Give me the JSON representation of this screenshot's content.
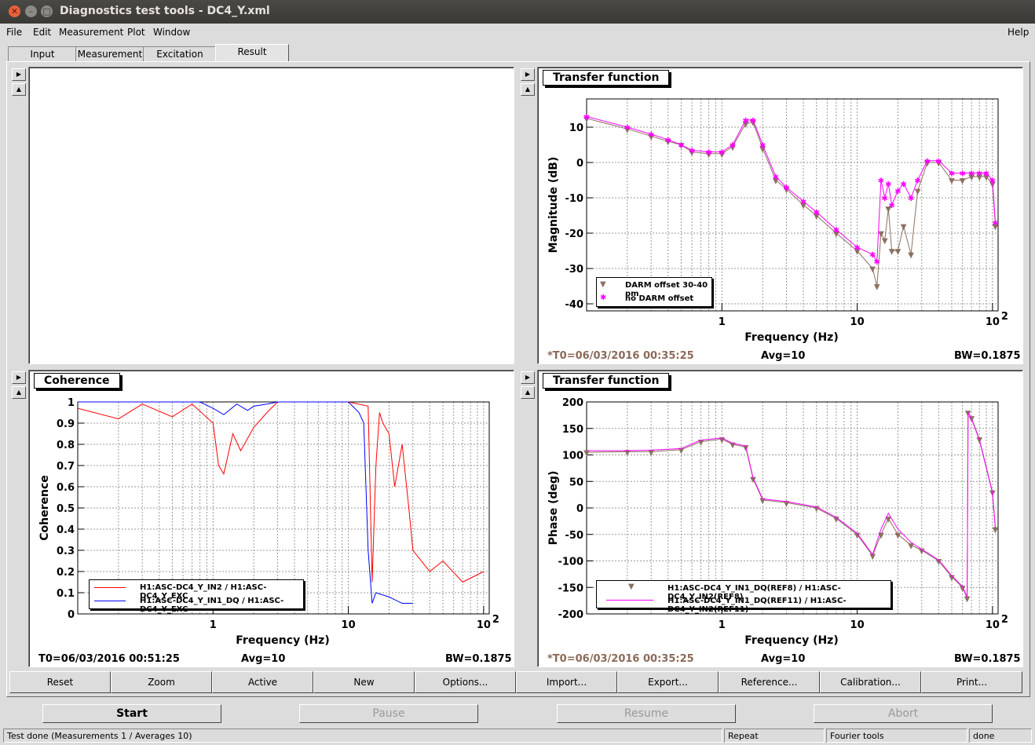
{
  "window": {
    "title": "Diagnostics test tools - DC4_Y.xml"
  },
  "menu": {
    "file": "File",
    "edit": "Edit",
    "measurement": "Measurement",
    "plot": "Plot",
    "window": "Window",
    "help": "Help"
  },
  "tabs": [
    "Input",
    "Measurement",
    "Excitation",
    "Result"
  ],
  "pads": {
    "tf_mag": {
      "title": "Transfer function",
      "ylabel": "Magnitude (dB)",
      "xlabel": "Frequency (Hz)",
      "yticks": [
        "10",
        "0",
        "-10",
        "-20",
        "-30",
        "-40"
      ],
      "xticks": [
        "1",
        "10",
        "10"
      ],
      "xsup": "2",
      "legend": [
        "DARM offset 30-40 pm",
        "no DARM offset"
      ],
      "foot": {
        "t0": "*T0=06/03/2016 00:35:25",
        "avg": "Avg=10",
        "bw": "BW=0.1875"
      }
    },
    "coherence": {
      "title": "Coherence",
      "ylabel": "Coherence",
      "xlabel": "Frequency (Hz)",
      "yticks": [
        "1",
        "0.9",
        "0.8",
        "0.7",
        "0.6",
        "0.5",
        "0.4",
        "0.3",
        "0.2",
        "0.1",
        "0"
      ],
      "xticks": [
        "1",
        "10",
        "10"
      ],
      "xsup": "2",
      "legend": [
        "H1:ASC-DC4_Y_IN2 / H1:ASC-DC4_Y_EXC",
        "H1:ASC-DC4_Y_IN1_DQ / H1:ASC-DC4_Y_EXC"
      ],
      "foot": {
        "t0": "T0=06/03/2016 00:51:25",
        "avg": "Avg=10",
        "bw": "BW=0.1875"
      }
    },
    "tf_phase": {
      "title": "Transfer function",
      "ylabel": "Phase (deg)",
      "xlabel": "Frequency (Hz)",
      "yticks": [
        "200",
        "150",
        "100",
        "50",
        "0",
        "-50",
        "-100",
        "-150",
        "-200"
      ],
      "xticks": [
        "1",
        "10",
        "10"
      ],
      "xsup": "2",
      "legend": [
        "H1:ASC-DC4_Y_IN1_DQ(REF8) / H1:ASC-DC4_Y_IN2(REF8)",
        "H1:ASC-DC4_Y_IN1_DQ(REF11) / H1:ASC-DC4_Y_IN2(REF11)"
      ],
      "foot": {
        "t0": "*T0=06/03/2016 00:35:25",
        "avg": "Avg=10",
        "bw": "BW=0.1875"
      }
    }
  },
  "colors": {
    "ref_brown": "#8b7060",
    "ref_magenta": "#ff00ff",
    "coh_red": "#ff0000",
    "coh_blue": "#0000ff",
    "foot_t0": "#8b6a5a"
  },
  "plot_buttons": [
    "Reset",
    "Zoom",
    "Active",
    "New",
    "Options...",
    "Import...",
    "Export...",
    "Reference...",
    "Calibration...",
    "Print..."
  ],
  "control_buttons": {
    "start": "Start",
    "pause": "Pause",
    "resume": "Resume",
    "abort": "Abort"
  },
  "status": {
    "message": "Test done (Measurements 1 / Averages 10)",
    "mode": "Repeat",
    "tool": "Fourier tools",
    "state": "done"
  },
  "chart_data": [
    {
      "type": "scatter",
      "title": "Transfer function",
      "xlabel": "Frequency (Hz)",
      "ylabel": "Magnitude (dB)",
      "xscale": "log",
      "xlim": [
        0.1,
        110
      ],
      "ylim": [
        -42,
        18
      ],
      "series": [
        {
          "name": "DARM offset 30-40 pm",
          "color": "#8b7060",
          "x": [
            0.1,
            0.2,
            0.3,
            0.4,
            0.5,
            0.6,
            0.8,
            1.0,
            1.2,
            1.5,
            1.7,
            2.0,
            2.5,
            3,
            4,
            5,
            7,
            10,
            13,
            14,
            15,
            16,
            17,
            18,
            20,
            22,
            25,
            28,
            33,
            40,
            50,
            60,
            70,
            80,
            90,
            100,
            105
          ],
          "y": [
            12.5,
            9.5,
            7.5,
            6,
            5,
            3,
            2.5,
            2.5,
            4.5,
            11,
            11.5,
            4,
            -5,
            -7.5,
            -12,
            -15,
            -20,
            -25,
            -30,
            -35,
            -20,
            -22,
            -13,
            -25,
            -25,
            -18,
            -26,
            -8,
            0,
            0,
            -5,
            -5,
            -4,
            -4,
            -4,
            -6,
            -18
          ]
        },
        {
          "name": "no DARM offset",
          "color": "#ff00ff",
          "x": [
            0.1,
            0.2,
            0.3,
            0.4,
            0.5,
            0.6,
            0.8,
            1.0,
            1.2,
            1.5,
            1.7,
            2.0,
            2.5,
            3,
            4,
            5,
            7,
            10,
            13,
            14,
            15,
            16,
            17,
            18,
            20,
            22,
            25,
            28,
            33,
            40,
            50,
            60,
            70,
            80,
            90,
            100,
            105
          ],
          "y": [
            13,
            10,
            8,
            6.5,
            5,
            3.5,
            3,
            3,
            5,
            12,
            12,
            5,
            -4,
            -7,
            -11,
            -14,
            -19,
            -24,
            -26,
            -28,
            -5,
            -10,
            -6,
            -12,
            -8,
            -6,
            -10,
            -5,
            0.5,
            0.5,
            -3,
            -3,
            -3,
            -3,
            -3,
            -5,
            -17
          ]
        }
      ]
    },
    {
      "type": "line",
      "title": "Coherence",
      "xlabel": "Frequency (Hz)",
      "ylabel": "Coherence",
      "xscale": "log",
      "xlim": [
        0.1,
        110
      ],
      "ylim": [
        0,
        1
      ],
      "series": [
        {
          "name": "H1:ASC-DC4_Y_IN2 / H1:ASC-DC4_Y_EXC",
          "color": "#ff0000",
          "x": [
            0.1,
            0.2,
            0.3,
            0.5,
            0.7,
            1.0,
            1.1,
            1.2,
            1.4,
            1.6,
            2.0,
            2.5,
            3,
            5,
            10,
            14,
            15,
            16,
            17,
            18,
            20,
            22,
            25,
            28,
            30,
            40,
            50,
            70,
            100
          ],
          "y": [
            0.97,
            0.92,
            0.99,
            0.93,
            0.99,
            0.9,
            0.7,
            0.66,
            0.85,
            0.77,
            0.88,
            0.95,
            1.0,
            1.0,
            1.0,
            0.98,
            0.15,
            0.7,
            0.95,
            0.9,
            0.85,
            0.6,
            0.8,
            0.5,
            0.3,
            0.2,
            0.25,
            0.15,
            0.2
          ]
        },
        {
          "name": "H1:ASC-DC4_Y_IN1_DQ / H1:ASC-DC4_Y_EXC",
          "color": "#0000ff",
          "x": [
            0.1,
            0.5,
            0.8,
            1.0,
            1.2,
            1.5,
            1.8,
            2.0,
            2.5,
            3.0,
            4,
            10,
            12,
            13,
            14,
            15,
            16,
            20,
            25,
            30
          ],
          "y": [
            1.0,
            1.0,
            1.0,
            0.97,
            0.94,
            0.99,
            0.96,
            0.98,
            0.99,
            1.0,
            1.0,
            1.0,
            0.95,
            0.9,
            0.3,
            0.05,
            0.1,
            0.08,
            0.05,
            0.05
          ]
        }
      ]
    },
    {
      "type": "scatter",
      "title": "Transfer function",
      "xlabel": "Frequency (Hz)",
      "ylabel": "Phase (deg)",
      "xscale": "log",
      "xlim": [
        0.1,
        110
      ],
      "ylim": [
        -200,
        200
      ],
      "series": [
        {
          "name": "H1:ASC-DC4_Y_IN1_DQ(REF8) / H1:ASC-DC4_Y_IN2(REF8)",
          "color": "#8b7060",
          "x": [
            0.1,
            0.2,
            0.3,
            0.5,
            0.7,
            1.0,
            1.2,
            1.5,
            1.7,
            2.0,
            3,
            5,
            7,
            10,
            13,
            15,
            17,
            20,
            25,
            30,
            40,
            50,
            60,
            65,
            66,
            70,
            80,
            100,
            105
          ],
          "y": [
            105,
            106,
            106,
            110,
            125,
            130,
            120,
            115,
            55,
            15,
            10,
            0,
            -20,
            -50,
            -90,
            -50,
            -20,
            -50,
            -70,
            -80,
            -100,
            -130,
            -150,
            -170,
            180,
            170,
            130,
            30,
            -40
          ]
        },
        {
          "name": "H1:ASC-DC4_Y_IN1_DQ(REF11) / H1:ASC-DC4_Y_IN2(REF11)",
          "color": "#ff00ff",
          "x": [
            0.1,
            0.2,
            0.3,
            0.5,
            0.7,
            1.0,
            1.2,
            1.5,
            1.7,
            2.0,
            3,
            5,
            7,
            10,
            13,
            15,
            17,
            20,
            25,
            30,
            40,
            50,
            60,
            65,
            66,
            70,
            80,
            100,
            105
          ],
          "y": [
            108,
            108,
            109,
            112,
            128,
            132,
            122,
            117,
            57,
            17,
            12,
            2,
            -18,
            -48,
            -88,
            -40,
            -10,
            -40,
            -65,
            -78,
            -98,
            -128,
            -148,
            -168,
            180,
            168,
            128,
            28,
            -38
          ]
        }
      ]
    }
  ]
}
